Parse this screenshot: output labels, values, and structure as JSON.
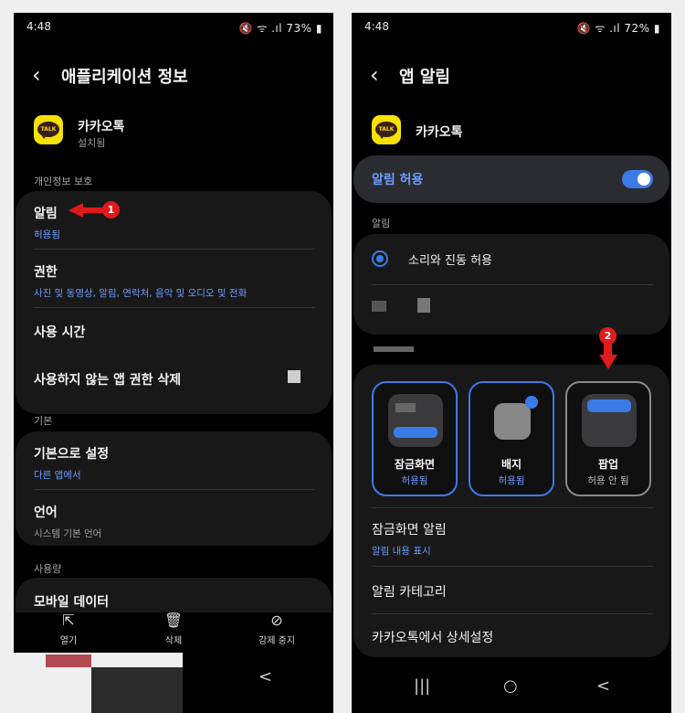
{
  "left": {
    "status": {
      "time": "4:48",
      "battery": "73%"
    },
    "title": "애플리케이션 정보",
    "app": {
      "name": "카카오톡",
      "status": "설치됨"
    },
    "sections": {
      "privacy": "개인정보 보호",
      "defaults": "기본",
      "usage": "사용량"
    },
    "items": {
      "notifications": {
        "label": "알림",
        "sub": "허용됨"
      },
      "permissions": {
        "label": "권한",
        "sub": "사진 및 동영상, 알림, 연락처, 음악 및 오디오 및 전화"
      },
      "usage_time": {
        "label": "사용 시간"
      },
      "remove_perms": {
        "label": "사용하지 않는 앱 권한 삭제"
      },
      "set_default": {
        "label": "기본으로 설정",
        "sub": "다른 앱에서"
      },
      "language": {
        "label": "언어",
        "sub": "시스템 기본 언어"
      },
      "mobile_data": {
        "label": "모바일 데이터"
      }
    },
    "bottom": {
      "open": "열기",
      "delete": "삭제",
      "force_stop": "강제 중지"
    },
    "marker": "1",
    "nav_back": "<"
  },
  "right": {
    "status": {
      "time": "4:48",
      "battery": "72%"
    },
    "title": "앱 알림",
    "app": {
      "name": "카카오톡"
    },
    "allow": {
      "label": "알림 허용",
      "enabled": true
    },
    "section_alert": "알림",
    "sound_option": "소리와 진동 허용",
    "styles": [
      {
        "label": "잠금화면",
        "sub": "허용됨",
        "selected": true
      },
      {
        "label": "배지",
        "sub": "허용됨",
        "selected": true
      },
      {
        "label": "팝업",
        "sub": "허용 안 됨",
        "selected": false
      }
    ],
    "lockscreen": {
      "label": "잠금화면 알림",
      "sub": "알림 내용 표시"
    },
    "category": "알림 카테고리",
    "details": "카카오톡에서 상세설정",
    "marker": "2",
    "nav": {
      "recent": "|||",
      "home": "○",
      "back": "<"
    }
  },
  "colors": {
    "accent": "#3b7be6",
    "link": "#6d9dff",
    "marker": "#e01a1a",
    "kakao": "#f7e100"
  },
  "icons": [
    "back-icon",
    "kakao-talk-icon",
    "open-icon",
    "trash-icon",
    "stop-icon",
    "toggle-icon",
    "radio-icon",
    "nav-back-icon",
    "nav-home-icon",
    "nav-recent-icon"
  ]
}
